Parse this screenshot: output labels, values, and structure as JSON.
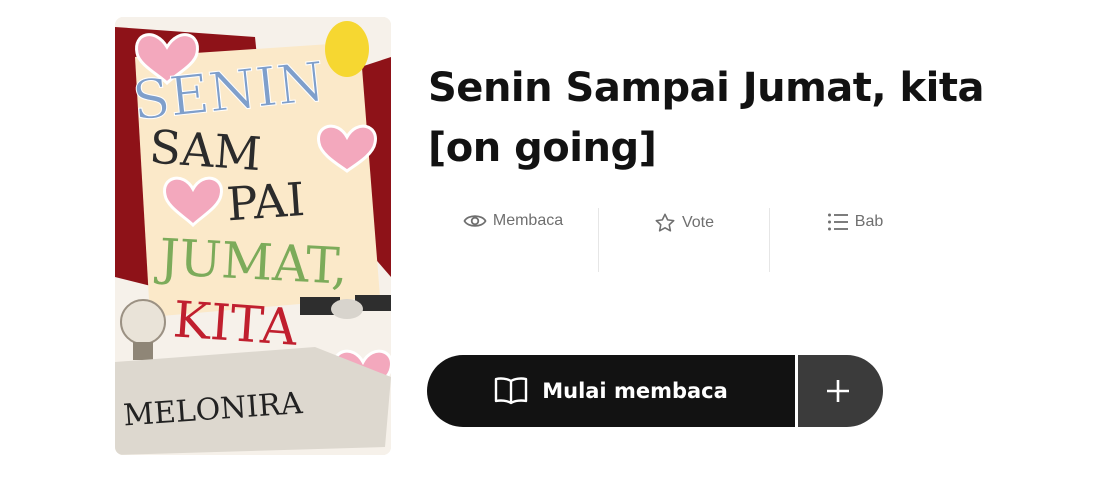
{
  "story": {
    "title": "Senin Sampai Jumat, kita [on going]",
    "cover": {
      "line1": "SENIN",
      "line2": "SAM",
      "line3": "PAI",
      "line4": "JUMAT,",
      "line5": "KITA",
      "author": "MELONIRA"
    }
  },
  "stats": [
    {
      "icon": "eye-icon",
      "label": "Membaca"
    },
    {
      "icon": "star-icon",
      "label": "Vote"
    },
    {
      "icon": "list-icon",
      "label": "Bab"
    }
  ],
  "actions": {
    "read_label": "Mulai membaca",
    "add_label": "+"
  },
  "colors": {
    "button_dark": "#121212",
    "button_add": "#3b3b3b",
    "muted_text": "#6f6f6f"
  }
}
